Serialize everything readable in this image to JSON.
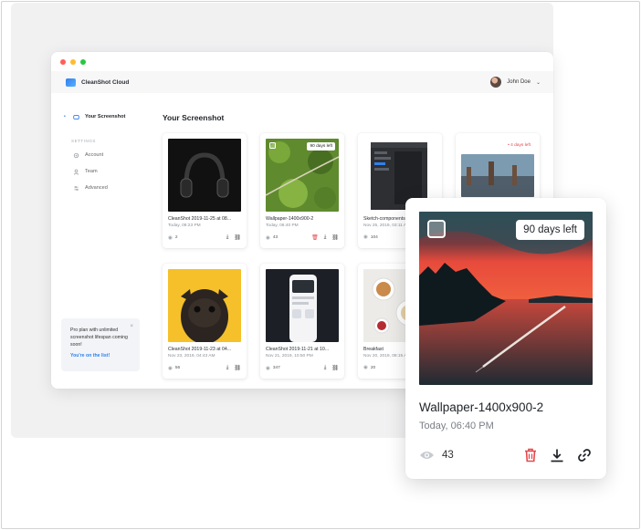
{
  "app": {
    "name": "CleanShot Cloud"
  },
  "user": {
    "name": "John Doe"
  },
  "sidebar": {
    "items": [
      {
        "label": "Your Screenshot",
        "active": true
      }
    ],
    "settings_heading": "SETTINGS",
    "settings": [
      {
        "label": "Account",
        "icon": "gear-icon"
      },
      {
        "label": "Team",
        "icon": "team-icon"
      },
      {
        "label": "Advanced",
        "icon": "advanced-icon"
      }
    ],
    "promo": {
      "text": "Pro plan with unlimited screenshot lifespan coming soon!",
      "link": "You're on the list!"
    }
  },
  "main": {
    "title": "Your Screenshot"
  },
  "cards": [
    {
      "title": "CleanShot 2019-11-25 at 08...",
      "date": "Today, 08:23 PM",
      "views": "2"
    },
    {
      "title": "Wallpaper-1400x900-2",
      "date": "Today, 06:40 PM",
      "views": "43",
      "badge": "90 days left"
    },
    {
      "title": "Sketch-components",
      "date": "Nov 25, 2019, 03:11 AM",
      "views": "104"
    },
    {
      "title": "",
      "date": "",
      "views": "",
      "note": "• 4 days left"
    },
    {
      "title": "CleanShot 2019-11-23 at 04...",
      "date": "Nov 23, 2019, 04:43 AM",
      "views": "56"
    },
    {
      "title": "CleanShot 2019-11-21 at 10...",
      "date": "Nov 21, 2019, 10:50 PM",
      "views": "347"
    },
    {
      "title": "Breakfast",
      "date": "Nov 20, 2019, 08:15 AM",
      "views": "20"
    }
  ],
  "popup": {
    "badge": "90 days left",
    "title": "Wallpaper-1400x900-2",
    "date": "Today, 06:40 PM",
    "views": "43"
  },
  "colors": {
    "accent": "#2f80ed",
    "danger": "#e5484d",
    "traffic_red": "#ff5f57",
    "traffic_yellow": "#febc2e",
    "traffic_green": "#28c840"
  }
}
